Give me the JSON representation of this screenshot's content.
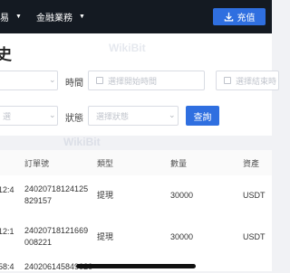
{
  "nav": {
    "item_partial": "易",
    "finance": "金融業務",
    "recharge_label": "充值",
    "recharge_icon": "download-icon"
  },
  "page": {
    "title_partial": "史"
  },
  "filters": {
    "time_label": "時間",
    "start_placeholder": "選擇開始時間",
    "end_placeholder": "選擇結束時",
    "left_partial_1": "",
    "left_partial_2": "選",
    "status_label": "狀態",
    "status_placeholder": "選擇狀態",
    "query_button": "查詢"
  },
  "table": {
    "headers": [
      "訂單號",
      "類型",
      "數量",
      "資產"
    ],
    "rows": [
      {
        "time": "12:4",
        "order": "24020718124125829157",
        "type": "提現",
        "amount": "30000",
        "asset": "USDT"
      },
      {
        "time": "12:1",
        "order": "24020718121669008221",
        "type": "提現",
        "amount": "30000",
        "asset": "USDT"
      },
      {
        "time": "58:4",
        "order": "240206145849020",
        "type": "",
        "amount": "",
        "asset": ""
      }
    ]
  },
  "watermark": "WikiBit",
  "colors": {
    "topbar": "#141a22",
    "accent": "#2f6fe0",
    "background": "#f1f2f5"
  }
}
